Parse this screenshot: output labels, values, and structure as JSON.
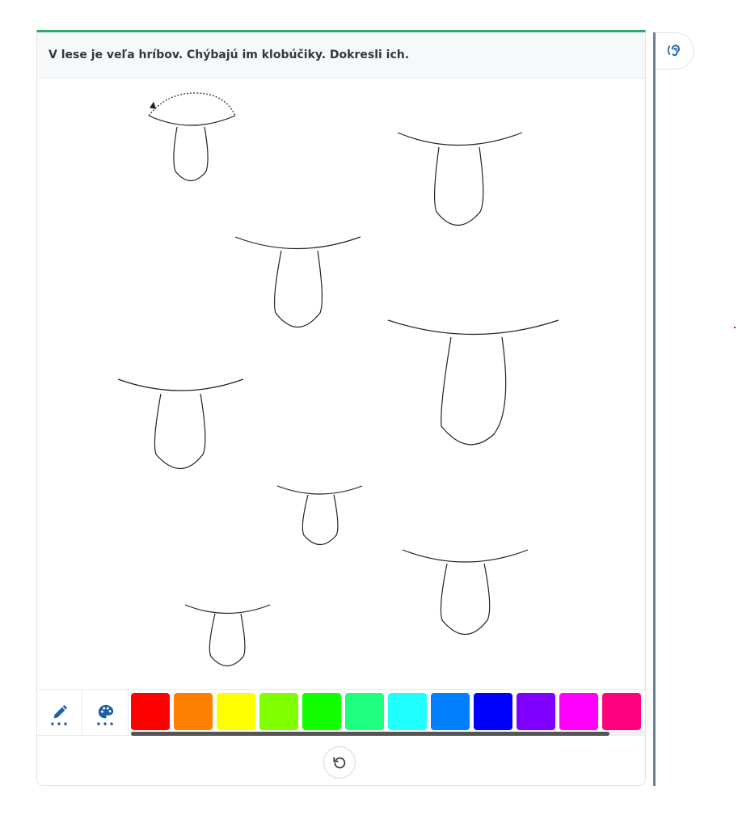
{
  "instruction": "V lese je veľa hríbov. Chýbajú im klobúčiky. Dokresli ich.",
  "tools": [
    {
      "name": "pencil-icon",
      "active": true
    },
    {
      "name": "palette-icon",
      "active": false
    }
  ],
  "palette": [
    "#ff0000",
    "#ff7f00",
    "#ffff00",
    "#7fff00",
    "#12ff00",
    "#1fff7f",
    "#1fffff",
    "#007fff",
    "#0000ff",
    "#7f00ff",
    "#ff00ff",
    "#ff007f"
  ],
  "accent_color": "#2eaa6a",
  "icons": {
    "reset": "reset-icon",
    "audio": "ear-icon"
  }
}
